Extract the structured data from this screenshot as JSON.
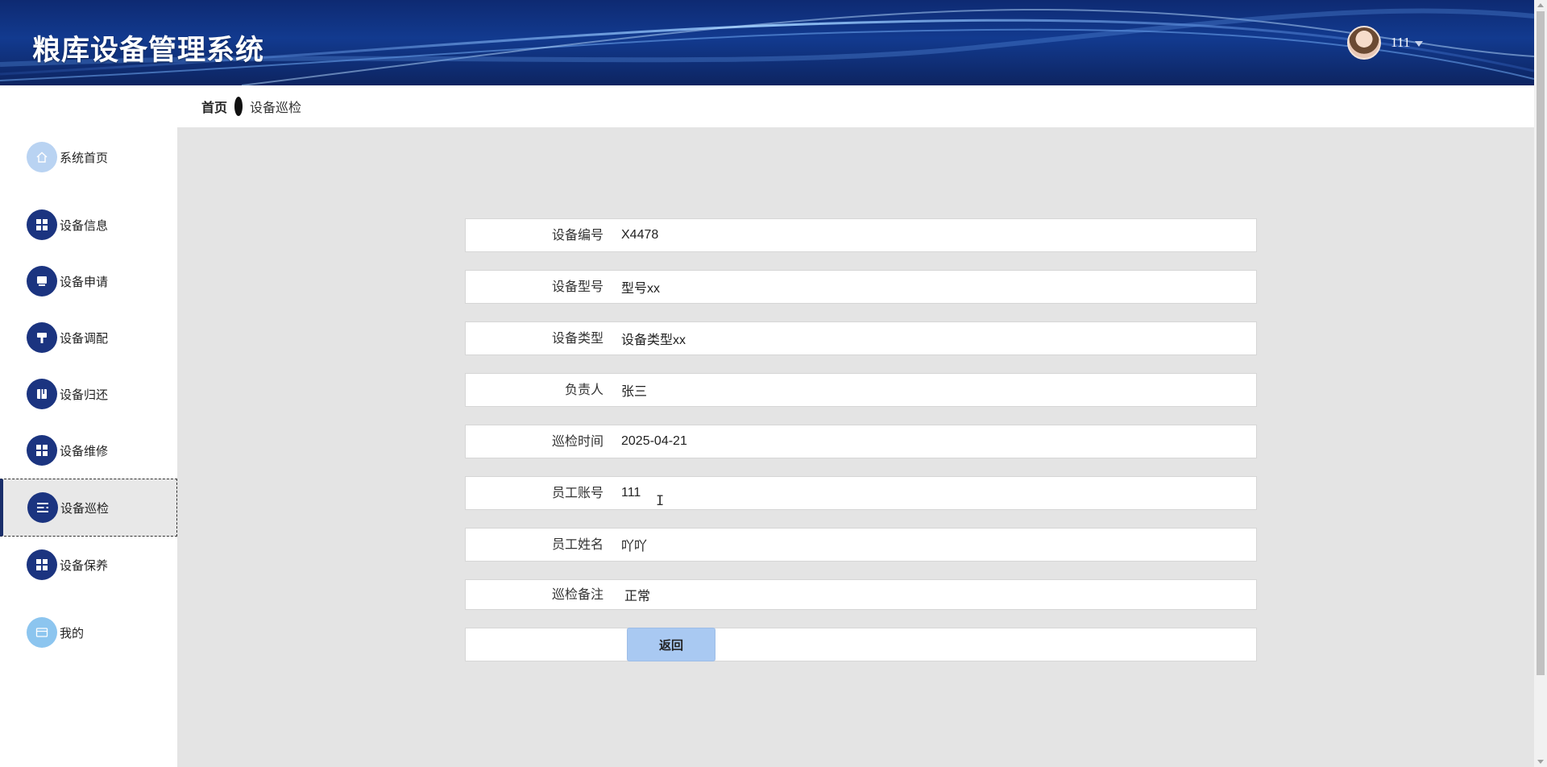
{
  "header": {
    "title": "粮库设备管理系统",
    "username": "111",
    "brand_color": "#123a8f"
  },
  "breadcrumb": {
    "home": "首页",
    "current": "设备巡检"
  },
  "sidebar": {
    "items": [
      {
        "label": "系统首页",
        "icon": "home-icon"
      },
      {
        "label": "设备信息",
        "icon": "grid-icon"
      },
      {
        "label": "设备申请",
        "icon": "monitor-icon"
      },
      {
        "label": "设备调配",
        "icon": "hammer-icon"
      },
      {
        "label": "设备归还",
        "icon": "book-icon"
      },
      {
        "label": "设备维修",
        "icon": "grid-icon"
      },
      {
        "label": "设备巡检",
        "icon": "list-icon",
        "active": true
      },
      {
        "label": "设备保养",
        "icon": "grid-icon"
      },
      {
        "label": "我的",
        "icon": "card-icon"
      }
    ]
  },
  "form": {
    "fields": [
      {
        "label": "设备编号",
        "value": "X4478"
      },
      {
        "label": "设备型号",
        "value": "型号xx"
      },
      {
        "label": "设备类型",
        "value": "设备类型xx"
      },
      {
        "label": "负责人",
        "value": "张三"
      },
      {
        "label": "巡检时间",
        "value": "2025-04-21"
      },
      {
        "label": "员工账号",
        "value": "111"
      },
      {
        "label": "员工姓名",
        "value": "吖吖"
      },
      {
        "label": "巡检备注",
        "value": "正常"
      }
    ],
    "back_label": "返回"
  }
}
